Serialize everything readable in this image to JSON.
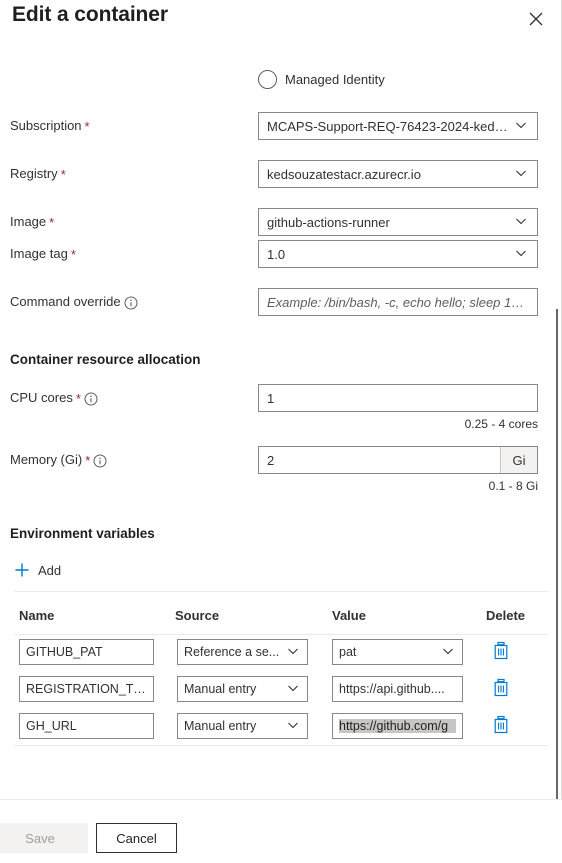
{
  "panel": {
    "title": "Edit a container",
    "close_icon": "close-icon"
  },
  "identity": {
    "option_label": "Managed Identity",
    "selected": false
  },
  "form": {
    "subscription": {
      "label": "Subscription",
      "required": "*",
      "value": "MCAPS-Support-REQ-76423-2024-keds...",
      "control": "dropdown"
    },
    "registry": {
      "label": "Registry",
      "required": "*",
      "value": "kedsouzatestacr.azurecr.io",
      "control": "dropdown"
    },
    "image": {
      "label": "Image",
      "required": "*",
      "value": "github-actions-runner",
      "control": "dropdown"
    },
    "image_tag": {
      "label": "Image tag",
      "required": "*",
      "value": "1.0",
      "control": "dropdown"
    },
    "command_override": {
      "label": "Command override",
      "info": true,
      "placeholder": "Example: /bin/bash, -c, echo hello; sleep 100...",
      "value": "",
      "control": "textbox"
    }
  },
  "resources": {
    "heading": "Container resource allocation",
    "cpu": {
      "label": "CPU cores",
      "required": "*",
      "info": true,
      "value": "1",
      "hint": "0.25 - 4 cores"
    },
    "memory": {
      "label": "Memory (Gi)",
      "required": "*",
      "info": true,
      "value": "2",
      "suffix": "Gi",
      "hint": "0.1 - 8 Gi"
    }
  },
  "env_vars": {
    "heading": "Environment variables",
    "add_label": "Add",
    "add_icon": "plus-icon",
    "columns": [
      "Name",
      "Source",
      "Value",
      "Delete"
    ],
    "rows": [
      {
        "name": "GITHUB_PAT",
        "source": "Reference a se...",
        "value": "pat",
        "value_control": "dropdown",
        "value_selected": false,
        "delete_icon": "trash-icon"
      },
      {
        "name": "REGISTRATION_TO...",
        "source": "Manual entry",
        "value": "https://api.github....",
        "value_control": "textbox",
        "value_selected": false,
        "delete_icon": "trash-icon"
      },
      {
        "name": "GH_URL",
        "source": "Manual entry",
        "value": "https://github.com/g",
        "value_control": "textbox",
        "value_selected": true,
        "delete_icon": "trash-icon"
      }
    ]
  },
  "footer": {
    "save_label": "Save",
    "save_disabled": true,
    "cancel_label": "Cancel"
  },
  "colors": {
    "accent": "#0078d4",
    "required_asterisk": "#a4262c",
    "border": "#8a8886",
    "text": "#323130",
    "disabled_bg": "#f3f2f1",
    "selection_highlight": "#c8c6c4"
  }
}
